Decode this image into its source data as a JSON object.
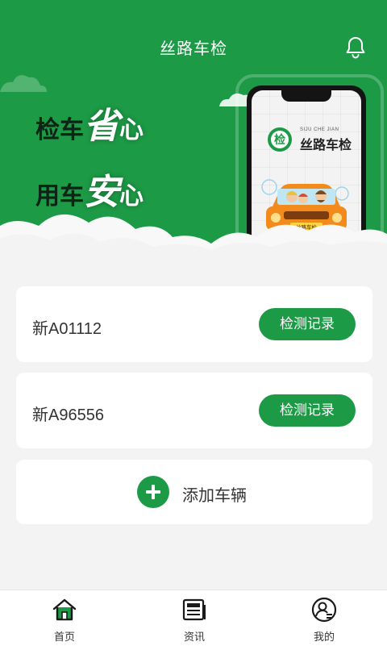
{
  "header": {
    "title": "丝路车检"
  },
  "banner": {
    "slogan_line1_small": "检车",
    "slogan_line1_big": "省",
    "slogan_line1_end": "心",
    "slogan_line2_small": "用车",
    "slogan_line2_big": "安",
    "slogan_line2_end": "心",
    "app_logo_text": "丝路车检",
    "app_logo_subtext": "SIJU CHE JIAN",
    "app_logo_glyph": "检",
    "car_plate_text": "丝路车检"
  },
  "vehicles": [
    {
      "plate": "新A01112",
      "button_label": "检测记录"
    },
    {
      "plate": "新A96556",
      "button_label": "检测记录"
    }
  ],
  "add_vehicle": {
    "label": "添加车辆"
  },
  "tabbar": {
    "items": [
      {
        "label": "首页",
        "icon": "home-icon",
        "active": true
      },
      {
        "label": "资讯",
        "icon": "news-icon",
        "active": false
      },
      {
        "label": "我的",
        "icon": "user-icon",
        "active": false
      }
    ]
  },
  "colors": {
    "brand_green": "#1d9a46",
    "background": "#f2f3f2"
  }
}
